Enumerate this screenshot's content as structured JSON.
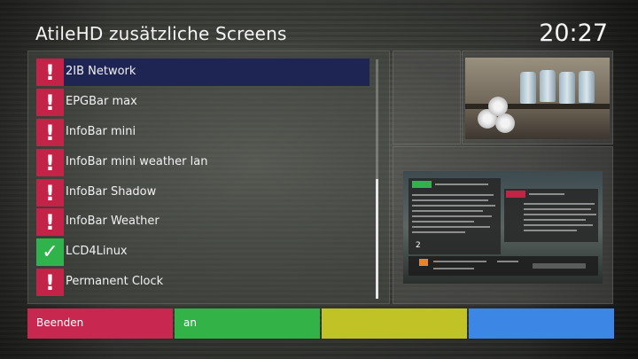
{
  "header": {
    "title": "AtileHD zusätzliche Screens",
    "clock": "20:27"
  },
  "list": {
    "items": [
      {
        "label": "2IB Network",
        "status": "warning",
        "glyph": "!"
      },
      {
        "label": "EPGBar max",
        "status": "warning",
        "glyph": "!"
      },
      {
        "label": "InfoBar mini",
        "status": "warning",
        "glyph": "!"
      },
      {
        "label": "InfoBar mini weather lan",
        "status": "warning",
        "glyph": "!"
      },
      {
        "label": "InfoBar Shadow",
        "status": "warning",
        "glyph": "!"
      },
      {
        "label": "InfoBar Weather",
        "status": "warning",
        "glyph": "!"
      },
      {
        "label": "LCD4Linux",
        "status": "enabled",
        "glyph": "✓"
      },
      {
        "label": "Permanent Clock",
        "status": "warning",
        "glyph": "!"
      }
    ],
    "selected_index": 0
  },
  "preview": {
    "channel_number": "2"
  },
  "footer": {
    "red_label": "Beenden",
    "green_label": "an",
    "yellow_label": "",
    "blue_label": ""
  },
  "colors": {
    "selected_row": "#1f2553",
    "warning": "#c42348",
    "enabled": "#2fb34a",
    "red": "#c8284f",
    "green": "#33b247",
    "yellow": "#c0c226",
    "blue": "#3c86e6"
  }
}
